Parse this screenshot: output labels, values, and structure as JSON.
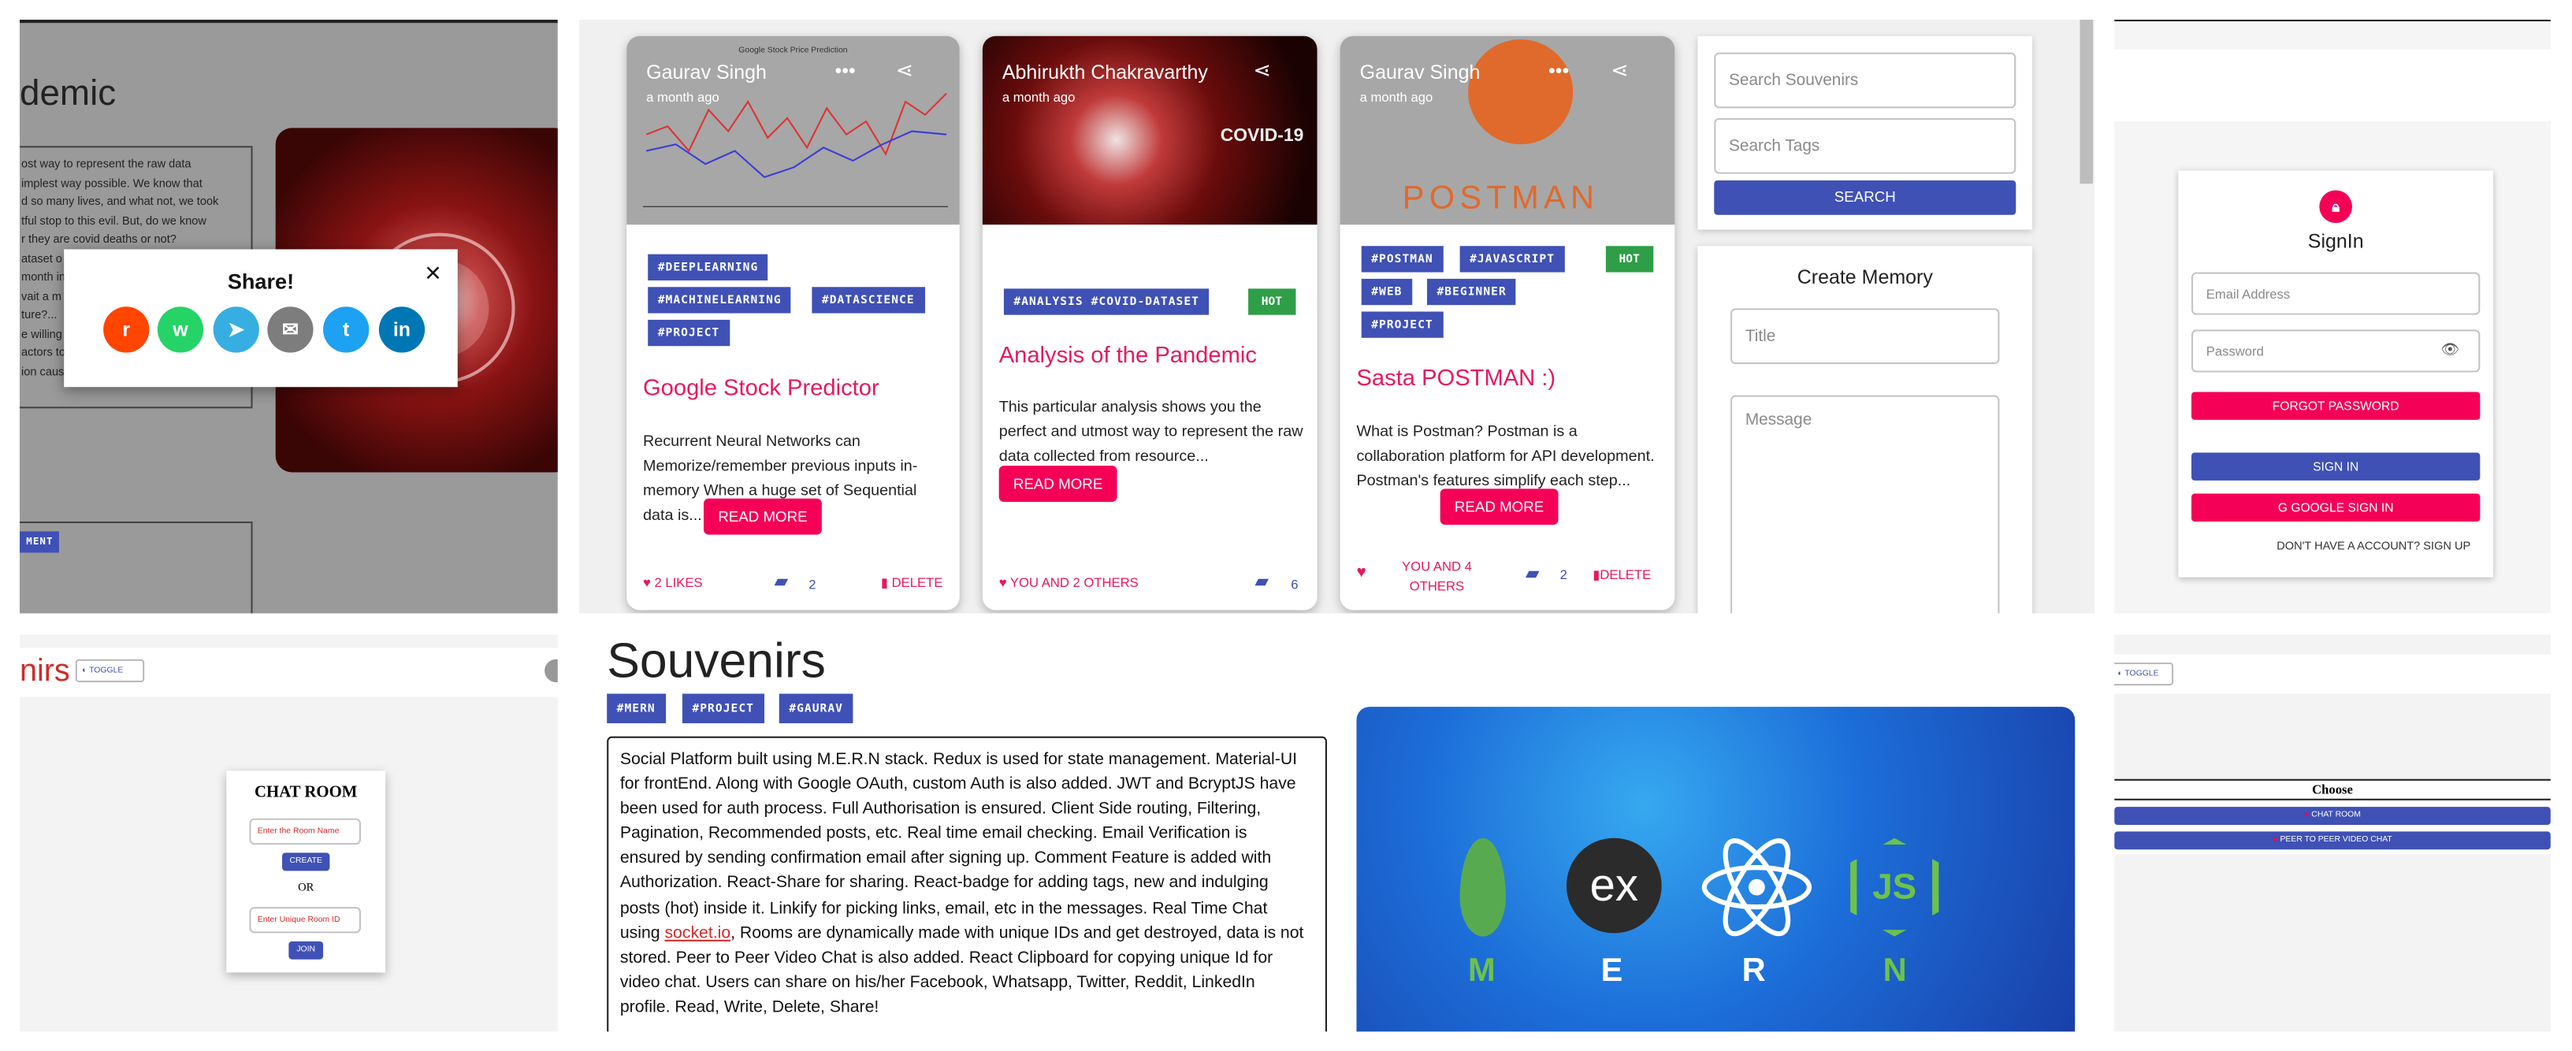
{
  "top_left": {
    "heading": "demic",
    "article_lines": [
      "ost way to represent the raw data",
      "implest way possible. We know that",
      "d so many lives, and what not, we took",
      "tful stop to this evil. But, do we know",
      "r they are covid deaths or not?",
      "ataset o",
      "month in",
      "vait a m",
      "ture?...",
      "e willing",
      "actors to",
      "ion caused by humans."
    ],
    "share": {
      "title": "Share!",
      "close": "×"
    },
    "comment_btn": "MENT"
  },
  "feed": {
    "cards": [
      {
        "author": "Gaurav Singh",
        "time": "a month ago",
        "chart_title": "Google Stock Price Prediction",
        "tags": [
          "#DEEPLEARNING",
          "#MACHINELEARNING",
          "#DATASCIENCE",
          "#PROJECT"
        ],
        "title": "Google Stock Predictor",
        "body": "Recurrent Neural Networks can Memorize/remember previous inputs in-memory When a huge set of Sequential data is...",
        "read_more": "READ MORE",
        "likes": "2 LIKES",
        "comments": "2",
        "delete": "DELETE"
      },
      {
        "author": "Abhirukth Chakravarthy",
        "time": "a month ago",
        "image_text": "COVID-19",
        "tags": [
          "#ANALYSIS #COVID-DATASET"
        ],
        "hot": "HOT",
        "title": "Analysis of the Pandemic",
        "body": "This particular analysis shows you the perfect and utmost way to represent the raw data collected from resource...",
        "read_more": "READ MORE",
        "likes": "YOU AND 2 OTHERS",
        "comments": "6"
      },
      {
        "author": "Gaurav Singh",
        "time": "a month ago",
        "image_text": "POSTMAN",
        "tags": [
          "#POSTMAN",
          "#JAVASCRIPT",
          "#WEB",
          "#BEGINNER",
          "#PROJECT"
        ],
        "hot": "HOT",
        "title": "Sasta POSTMAN :)",
        "body": "What is Postman? Postman is a collaboration platform for API development. Postman's features simplify each step...",
        "read_more": "READ MORE",
        "likes_line1": "YOU AND 4",
        "likes_line2": "OTHERS",
        "comments": "2",
        "delete": "DELETE"
      }
    ],
    "search": {
      "souvenirs_placeholder": "Search Souvenirs",
      "tags_placeholder": "Search Tags",
      "button": "SEARCH"
    },
    "create": {
      "title": "Create Memory",
      "title_placeholder": "Title",
      "message_placeholder": "Message"
    }
  },
  "signin": {
    "title": "SignIn",
    "email_placeholder": "Email Address",
    "password_placeholder": "Password",
    "forgot": "FORGOT PASSWORD",
    "signin": "SIGN IN",
    "google": "GOOGLE SIGN IN",
    "signup": "DON'T HAVE A ACCOUNT? SIGN UP"
  },
  "chat": {
    "brand": "nirs",
    "toggle": "TOGGLE",
    "title": "CHAT ROOM",
    "room_name_placeholder": "Enter the Room Name",
    "create": "CREATE",
    "or": "OR",
    "room_id_placeholder": "Enter Unique Room ID",
    "join": "JOIN"
  },
  "project": {
    "title": "Souvenirs",
    "tags": [
      "#MERN",
      "#PROJECT",
      "#GAURAV"
    ],
    "desc_lines": [
      "Social Platform built using M.E.R.N stack. Redux is used for state management. Material-UI",
      "for frontEnd. Along with Google OAuth, custom Auth is also added. JWT and BcryptJS have",
      "been used for auth process. Full Authorisation is ensured. Client Side routing, Filtering,",
      "Pagination, Recommended posts, etc. Real time email checking. Email Verification is",
      "ensured by sending confirmation email after signing up. Comment Feature is added with",
      "Authorization. React-Share for sharing. React-badge for adding tags, new and indulging",
      "posts (hot) inside it. Linkify for picking links, email, etc in the messages. Real Time Chat"
    ],
    "desc_pre": "using ",
    "desc_link": "socket.io",
    "desc_post": ", Rooms are dynamically made with unique IDs and get destroyed, data is not",
    "desc_lines2": [
      "stored. Peer to Peer Video Chat is also added. React Clipboard for copying unique Id for",
      "video chat. Users can share on his/her Facebook, Whatsapp, Twitter, Reddit, LinkedIn",
      "profile. Read, Write, Delete, Share!"
    ],
    "mern_letters": [
      "M",
      "E",
      "R",
      "N"
    ],
    "express_logo": "ex",
    "node_logo": "JS"
  },
  "choose": {
    "toggle": "TOGGLE",
    "title": "Choose",
    "chat": "CHAT ROOM",
    "video": "PEER TO PEER VIDEO CHAT"
  },
  "colors": {
    "primary": "#3f51b5",
    "secondary": "#f50057",
    "hot": "#2e9e47",
    "link": "#e5195f"
  }
}
